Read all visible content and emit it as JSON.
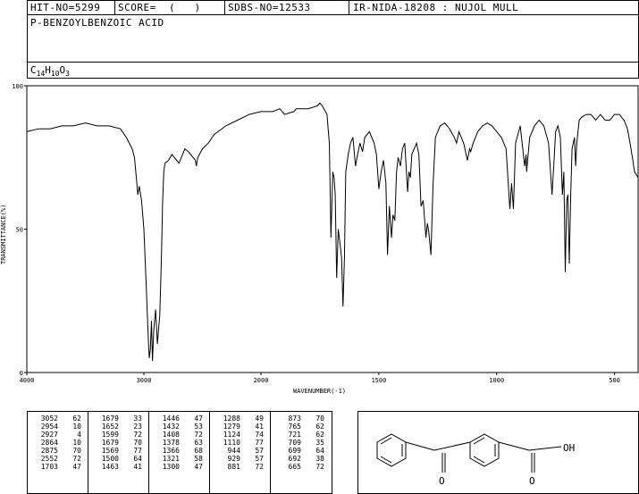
{
  "header": {
    "hit_no": "HIT-NO=5299",
    "score": "SCORE=  (   )",
    "sdbs_no": "SDBS-NO=12533",
    "ir_method": "IR-NIDA-18208 : NUJOL MULL",
    "compound_name": "P-BENZOYLBENZOIC ACID",
    "formula_c": "C",
    "formula_c_n": "14",
    "formula_h": "H",
    "formula_h_n": "10",
    "formula_o": "O",
    "formula_o_n": "3"
  },
  "chart_data": {
    "type": "line",
    "xlabel": "WAVENUMBER(-1)",
    "ylabel": "TRANSMITTANCE(%)",
    "xlim": [
      4000,
      400
    ],
    "ylim": [
      0,
      100
    ],
    "x_ticks": [
      "4000",
      "3000",
      "2000",
      "1500",
      "1000",
      "500"
    ],
    "y_ticks": [
      "100",
      "50",
      "0"
    ],
    "series": [
      {
        "points": [
          [
            4000,
            84
          ],
          [
            3900,
            85
          ],
          [
            3800,
            85
          ],
          [
            3700,
            86
          ],
          [
            3600,
            86
          ],
          [
            3500,
            87
          ],
          [
            3400,
            86
          ],
          [
            3300,
            86
          ],
          [
            3200,
            85
          ],
          [
            3150,
            82
          ],
          [
            3100,
            78
          ],
          [
            3080,
            75
          ],
          [
            3060,
            66
          ],
          [
            3052,
            62
          ],
          [
            3040,
            65
          ],
          [
            3020,
            60
          ],
          [
            3000,
            50
          ],
          [
            2985,
            35
          ],
          [
            2970,
            20
          ],
          [
            2960,
            10
          ],
          [
            2954,
            5
          ],
          [
            2945,
            8
          ],
          [
            2935,
            18
          ],
          [
            2927,
            4
          ],
          [
            2915,
            15
          ],
          [
            2900,
            22
          ],
          [
            2885,
            10
          ],
          [
            2875,
            15
          ],
          [
            2864,
            20
          ],
          [
            2850,
            40
          ],
          [
            2840,
            60
          ],
          [
            2830,
            70
          ],
          [
            2820,
            73
          ],
          [
            2790,
            74
          ],
          [
            2760,
            76
          ],
          [
            2720,
            74
          ],
          [
            2700,
            73
          ],
          [
            2680,
            75
          ],
          [
            2650,
            78
          ],
          [
            2620,
            77
          ],
          [
            2600,
            76
          ],
          [
            2560,
            74
          ],
          [
            2552,
            72
          ],
          [
            2540,
            75
          ],
          [
            2500,
            78
          ],
          [
            2450,
            80
          ],
          [
            2400,
            83
          ],
          [
            2300,
            86
          ],
          [
            2200,
            88
          ],
          [
            2100,
            90
          ],
          [
            2000,
            91
          ],
          [
            1950,
            91
          ],
          [
            1920,
            92
          ],
          [
            1900,
            90
          ],
          [
            1860,
            91
          ],
          [
            1850,
            92
          ],
          [
            1800,
            92
          ],
          [
            1760,
            93
          ],
          [
            1750,
            94
          ],
          [
            1740,
            93
          ],
          [
            1720,
            90
          ],
          [
            1710,
            80
          ],
          [
            1703,
            47
          ],
          [
            1695,
            70
          ],
          [
            1690,
            68
          ],
          [
            1685,
            62
          ],
          [
            1679,
            33
          ],
          [
            1672,
            50
          ],
          [
            1665,
            45
          ],
          [
            1658,
            40
          ],
          [
            1652,
            23
          ],
          [
            1646,
            40
          ],
          [
            1640,
            70
          ],
          [
            1630,
            76
          ],
          [
            1620,
            80
          ],
          [
            1610,
            82
          ],
          [
            1599,
            72
          ],
          [
            1590,
            76
          ],
          [
            1580,
            80
          ],
          [
            1569,
            77
          ],
          [
            1560,
            82
          ],
          [
            1540,
            84
          ],
          [
            1520,
            80
          ],
          [
            1510,
            76
          ],
          [
            1500,
            64
          ],
          [
            1490,
            70
          ],
          [
            1480,
            74
          ],
          [
            1470,
            66
          ],
          [
            1463,
            41
          ],
          [
            1455,
            58
          ],
          [
            1446,
            47
          ],
          [
            1440,
            55
          ],
          [
            1432,
            53
          ],
          [
            1425,
            70
          ],
          [
            1418,
            75
          ],
          [
            1408,
            72
          ],
          [
            1400,
            78
          ],
          [
            1390,
            80
          ],
          [
            1378,
            63
          ],
          [
            1372,
            70
          ],
          [
            1366,
            68
          ],
          [
            1360,
            76
          ],
          [
            1340,
            80
          ],
          [
            1330,
            76
          ],
          [
            1321,
            58
          ],
          [
            1312,
            60
          ],
          [
            1300,
            47
          ],
          [
            1294,
            52
          ],
          [
            1288,
            49
          ],
          [
            1279,
            41
          ],
          [
            1270,
            65
          ],
          [
            1260,
            82
          ],
          [
            1240,
            86
          ],
          [
            1220,
            87
          ],
          [
            1200,
            85
          ],
          [
            1180,
            82
          ],
          [
            1170,
            80
          ],
          [
            1160,
            84
          ],
          [
            1140,
            80
          ],
          [
            1124,
            74
          ],
          [
            1115,
            78
          ],
          [
            1110,
            77
          ],
          [
            1100,
            80
          ],
          [
            1080,
            84
          ],
          [
            1060,
            86
          ],
          [
            1040,
            87
          ],
          [
            1020,
            86
          ],
          [
            1000,
            84
          ],
          [
            980,
            82
          ],
          [
            960,
            78
          ],
          [
            944,
            57
          ],
          [
            937,
            66
          ],
          [
            929,
            57
          ],
          [
            920,
            80
          ],
          [
            900,
            86
          ],
          [
            881,
            72
          ],
          [
            875,
            76
          ],
          [
            873,
            70
          ],
          [
            860,
            82
          ],
          [
            840,
            86
          ],
          [
            820,
            88
          ],
          [
            800,
            86
          ],
          [
            780,
            80
          ],
          [
            765,
            62
          ],
          [
            758,
            72
          ],
          [
            750,
            84
          ],
          [
            740,
            86
          ],
          [
            730,
            82
          ],
          [
            721,
            62
          ],
          [
            715,
            70
          ],
          [
            709,
            35
          ],
          [
            703,
            60
          ],
          [
            698,
            62
          ],
          [
            692,
            38
          ],
          [
            686,
            62
          ],
          [
            680,
            78
          ],
          [
            670,
            82
          ],
          [
            665,
            72
          ],
          [
            660,
            80
          ],
          [
            650,
            88
          ],
          [
            640,
            89
          ],
          [
            620,
            90
          ],
          [
            600,
            90
          ],
          [
            580,
            88
          ],
          [
            560,
            90
          ],
          [
            540,
            88
          ],
          [
            520,
            88
          ],
          [
            500,
            90
          ],
          [
            480,
            90
          ],
          [
            460,
            88
          ],
          [
            445,
            85
          ],
          [
            430,
            78
          ],
          [
            415,
            70
          ],
          [
            400,
            68
          ]
        ]
      }
    ],
    "peak_table": [
      [
        [
          "3052",
          "62"
        ],
        [
          "2954",
          "10"
        ],
        [
          "2927",
          "4"
        ],
        [
          "2864",
          "10"
        ],
        [
          "2875",
          "70"
        ],
        [
          "2552",
          "72"
        ],
        [
          "1703",
          "47"
        ]
      ],
      [
        [
          "1679",
          "33"
        ],
        [
          "1652",
          "23"
        ],
        [
          "1599",
          "72"
        ],
        [
          "1679",
          "70"
        ],
        [
          "1569",
          "77"
        ],
        [
          "1500",
          "64"
        ],
        [
          "1463",
          "41"
        ]
      ],
      [
        [
          "1446",
          "47"
        ],
        [
          "1432",
          "53"
        ],
        [
          "1408",
          "72"
        ],
        [
          "1378",
          "63"
        ],
        [
          "1366",
          "68"
        ],
        [
          "1321",
          "58"
        ],
        [
          "1300",
          "47"
        ]
      ],
      [
        [
          "1288",
          "49"
        ],
        [
          "1279",
          "41"
        ],
        [
          "1124",
          "74"
        ],
        [
          "1110",
          "77"
        ],
        [
          "944",
          "57"
        ],
        [
          "929",
          "57"
        ],
        [
          "881",
          "72"
        ]
      ],
      [
        [
          "873",
          "70"
        ],
        [
          "765",
          "62"
        ],
        [
          "721",
          "62"
        ],
        [
          "709",
          "35"
        ],
        [
          "699",
          "64"
        ],
        [
          "692",
          "38"
        ],
        [
          "665",
          "72"
        ]
      ]
    ]
  },
  "structure": {
    "oh_label": "OH",
    "o_label_1": "O",
    "o_label_2": "O"
  }
}
